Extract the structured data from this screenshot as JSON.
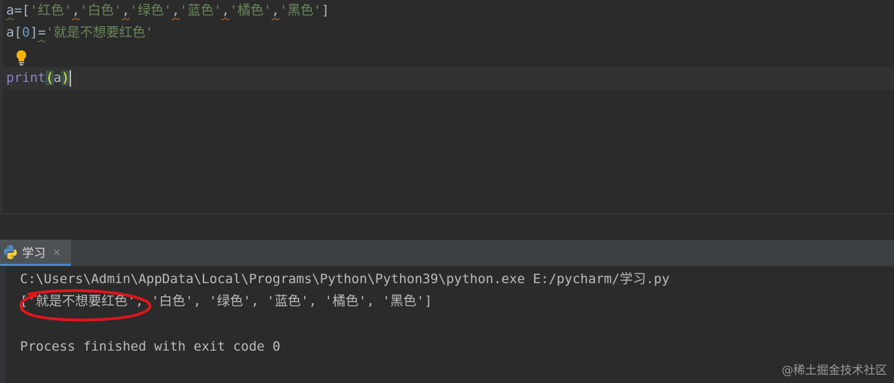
{
  "editor": {
    "line1": {
      "var": "a",
      "eq": "=",
      "open": "[",
      "items": [
        "'红色'",
        "'白色'",
        "'绿色'",
        "'蓝色'",
        "'橘色'",
        "'黑色'"
      ],
      "sep": ",",
      "close": "]"
    },
    "line2": {
      "var": "a",
      "open": "[",
      "index": "0",
      "close": "]",
      "eq": "=",
      "value": "'就是不想要红色'"
    },
    "line4": {
      "func": "print",
      "open": "(",
      "arg": "a",
      "close": ")"
    },
    "intention_icon": "lightbulb-icon"
  },
  "run_panel": {
    "tab_icon": "python-icon",
    "tab_label": "学习",
    "close_glyph": "×"
  },
  "console": {
    "command": "C:\\Users\\Admin\\AppData\\Local\\Programs\\Python\\Python39\\python.exe E:/pycharm/学习.py",
    "output": "['就是不想要红色', '白色', '绿色', '蓝色', '橘色', '黑色']",
    "exit_message": "Process finished with exit code 0"
  },
  "annotation": {
    "color": "#e0161b"
  },
  "watermark": "@稀土掘金技术社区"
}
